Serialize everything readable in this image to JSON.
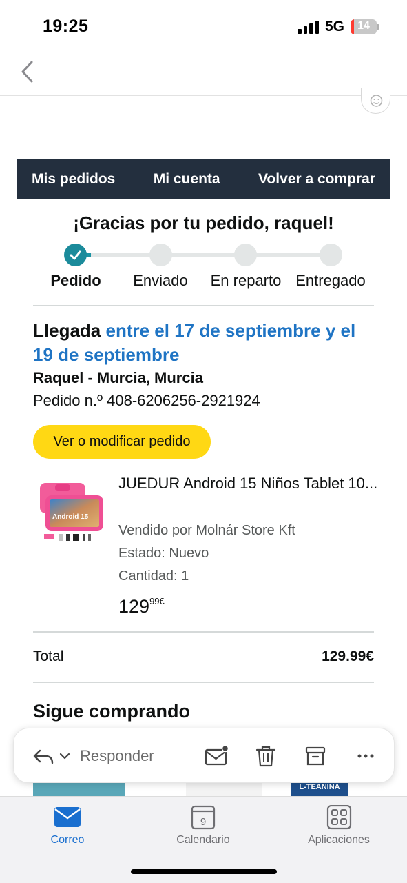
{
  "status": {
    "time": "19:25",
    "network": "5G",
    "battery": "14",
    "battery_level_percent": 14
  },
  "nav": {
    "back_icon": "chevron-left-icon",
    "emoji_icon": "smiley-icon"
  },
  "top_nav": {
    "items": [
      "Mis pedidos",
      "Mi cuenta",
      "Volver a comprar"
    ]
  },
  "heading": "¡Gracias por tu pedido, raquel!",
  "progress": {
    "steps": [
      "Pedido",
      "Enviado",
      "En reparto",
      "Entregado"
    ],
    "current_step": 1,
    "colors": {
      "done": "#1b8b9b",
      "pending": "#e3e6e6"
    }
  },
  "order": {
    "arrival_label": "Llegada",
    "arrival_range": "entre el 17 de septiembre y el 19 de septiembre",
    "address": "Raquel - Murcia, Murcia",
    "order_number": "Pedido n.º 408-6206256-2921924",
    "view_button": "Ver o modificar pedido"
  },
  "product": {
    "title": "JUEDUR Android 15 Niños Tablet 10...",
    "seller": "Vendido por Molnár Store Kft",
    "condition": "Estado: Nuevo",
    "quantity": "Cantidad: 1",
    "price_whole": "129",
    "price_fraction": "99€",
    "image_text": "Android 15"
  },
  "total": {
    "label": "Total",
    "value": "129.99€"
  },
  "keep_shopping": {
    "title": "Sigue comprando",
    "partial_item_text": "L-TEANINA"
  },
  "reply_bar": {
    "reply_label": "Responder",
    "icons": [
      "reply-icon",
      "chevron-down-icon",
      "mail-unread-icon",
      "trash-icon",
      "archive-icon",
      "more-icon"
    ]
  },
  "tabbar": {
    "tabs": [
      {
        "label": "Correo",
        "icon": "mail-icon",
        "active": true
      },
      {
        "label": "Calendario",
        "icon": "calendar-icon",
        "day": "9",
        "active": false
      },
      {
        "label": "Aplicaciones",
        "icon": "apps-grid-icon",
        "active": false
      }
    ]
  },
  "colors": {
    "accent_blue": "#1f74c4",
    "dark_nav": "#232f3e",
    "button_yellow": "#ffd814",
    "tab_active": "#1a6fcf"
  }
}
